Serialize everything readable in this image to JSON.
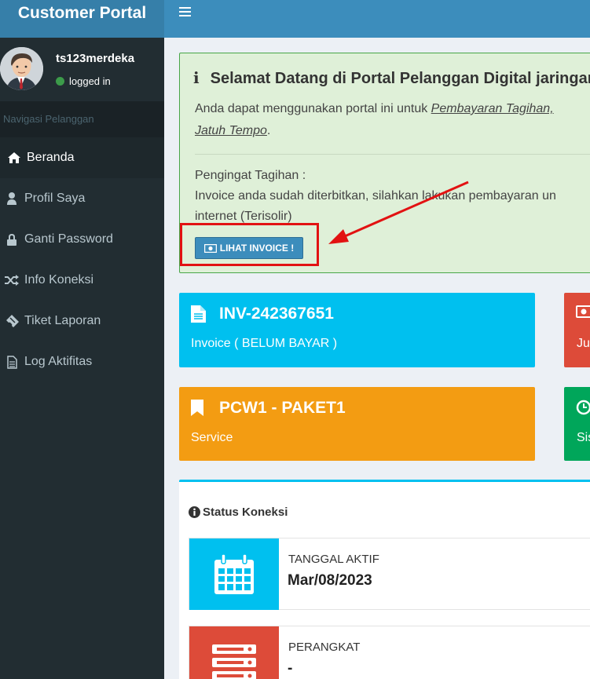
{
  "app": {
    "title": "Customer Portal"
  },
  "user": {
    "name": "ts123merdeka",
    "status": "logged in"
  },
  "sidebar": {
    "header": "Navigasi Pelanggan",
    "items": [
      {
        "label": "Beranda",
        "icon": "home-icon"
      },
      {
        "label": "Profil Saya",
        "icon": "user-icon"
      },
      {
        "label": "Ganti Password",
        "icon": "lock-icon"
      },
      {
        "label": "Info Koneksi",
        "icon": "random-icon"
      },
      {
        "label": "Tiket Laporan",
        "icon": "ticket-icon"
      },
      {
        "label": "Log Aktifitas",
        "icon": "file-text-icon"
      }
    ]
  },
  "callout": {
    "title": "Selamat Datang di Portal Pelanggan Digital jaringan",
    "text_prefix": "Anda dapat menggunakan portal ini untuk ",
    "link1": "Pembayaran Tagihan,",
    "link2": "Jatuh Tempo",
    "text_suffix": ".",
    "reminder_title": "Pengingat Tagihan :",
    "reminder_line1": "Invoice anda sudah diterbitkan, silahkan lakukan pembayaran un",
    "reminder_line2": "internet (Terisolir)",
    "button_label": "LIHAT INVOICE !"
  },
  "info_boxes": {
    "invoice": {
      "title": "INV-242367651",
      "subtitle": "Invoice ( BELUM BAYAR )"
    },
    "due": {
      "subtitle": "Ju"
    },
    "service": {
      "title": "PCW1 - PAKET1",
      "subtitle": "Service"
    },
    "remaining": {
      "subtitle": "Sis"
    }
  },
  "status": {
    "title": "Status Koneksi",
    "rows": [
      {
        "label": "TANGGAL AKTIF",
        "value": "Mar/08/2023"
      },
      {
        "label": "PERANGKAT",
        "value": "-"
      }
    ]
  },
  "colors": {
    "aqua": "#00c0ef",
    "red": "#dd4b39",
    "yellow": "#f39c12",
    "green": "#00a65a",
    "primary": "#3c8dbc",
    "annotation": "#e21212"
  }
}
